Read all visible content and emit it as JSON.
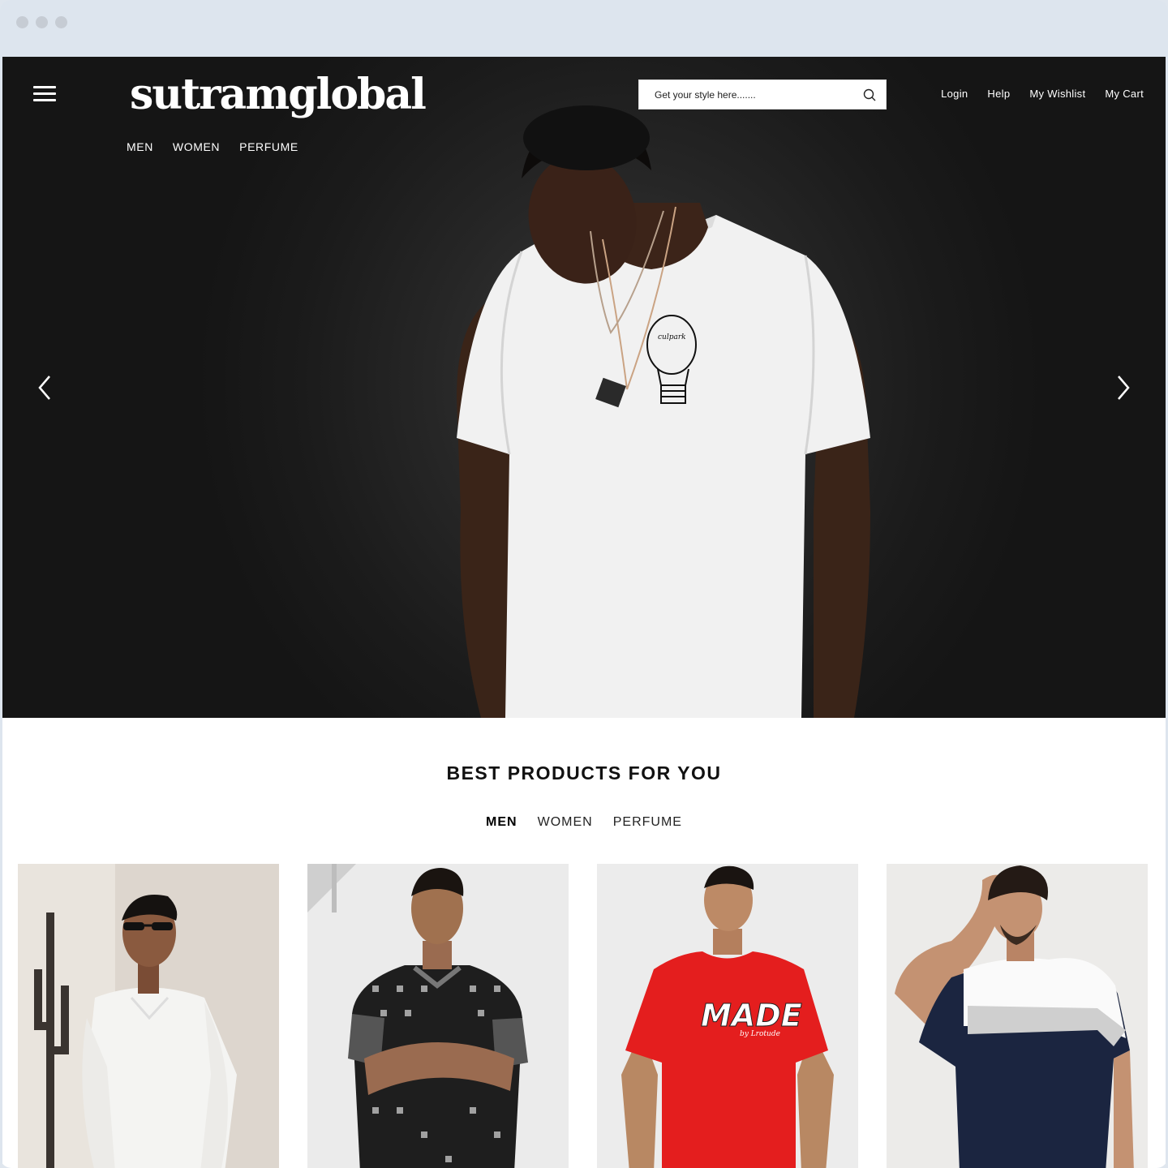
{
  "brand": {
    "logo": "sutramglobal"
  },
  "header": {
    "nav": [
      "MEN",
      "WOMEN",
      "PERFUME"
    ],
    "search": {
      "placeholder": "Get your style here......."
    },
    "account": {
      "login": "Login",
      "help": "Help",
      "wishlist": "My Wishlist",
      "cart": "My Cart"
    }
  },
  "hero": {
    "tshirt_print": "culpark",
    "icons": {
      "menu": "hamburger-icon",
      "prev": "chevron-left-icon",
      "next": "chevron-right-icon",
      "search": "search-icon"
    }
  },
  "products_section": {
    "title": "BEST PRODUCTS FOR YOU",
    "tabs": [
      {
        "label": "MEN",
        "active": true
      },
      {
        "label": "WOMEN",
        "active": false
      },
      {
        "label": "PERFUME",
        "active": false
      }
    ],
    "cards": [
      {
        "name": "white-knit-polo"
      },
      {
        "name": "black-pattern-polo"
      },
      {
        "name": "red-made-tshirt",
        "print": "MADE",
        "print_sub": "by Lrotude"
      },
      {
        "name": "colorblock-tshirt"
      }
    ]
  },
  "colors": {
    "hero_bg": "#1c1c1c",
    "text_dark": "#111111",
    "accent_red": "#e02020",
    "navy": "#1b2540"
  }
}
